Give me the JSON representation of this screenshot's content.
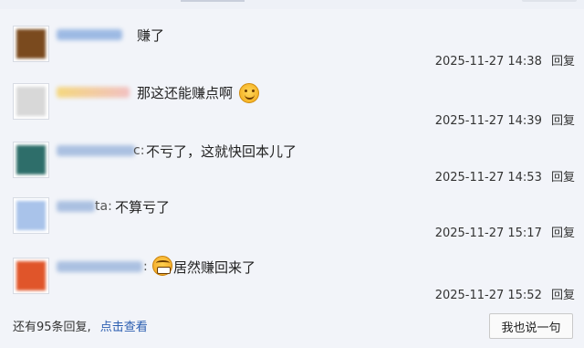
{
  "replies": [
    {
      "text": "赚了",
      "time": "2025-11-27 14:38",
      "reply_label": "回复",
      "avatar_color": "#7a4a1e",
      "name_color": "#8fb0e0"
    },
    {
      "text": "那这还能赚点啊",
      "emoji": "smile-emoji",
      "time": "2025-11-27 14:39",
      "reply_label": "回复",
      "avatar_color": "#d8d8d8",
      "name_color": "#f2b8b8"
    },
    {
      "name_suffix": "c:",
      "text": "不亏了，这就快回本儿了",
      "time": "2025-11-27 14:53",
      "reply_label": "回复",
      "avatar_color": "#2e6e6a",
      "name_color": "#9fb8dd"
    },
    {
      "name_suffix": "ta:",
      "text": "不算亏了",
      "time": "2025-11-27 15:17",
      "reply_label": "回复",
      "avatar_color": "#a9c3ea",
      "name_color": "#9fb8dd"
    },
    {
      "name_suffix": ":",
      "emoji": "grit-emoji",
      "text": "居然赚回来了",
      "time": "2025-11-27 15:52",
      "reply_label": "回复",
      "avatar_color": "#e0552a",
      "name_color": "#9fb8dd"
    }
  ],
  "footer": {
    "more_text": "还有95条回复,",
    "view_link": "点击查看"
  },
  "say_button": "我也说一句"
}
